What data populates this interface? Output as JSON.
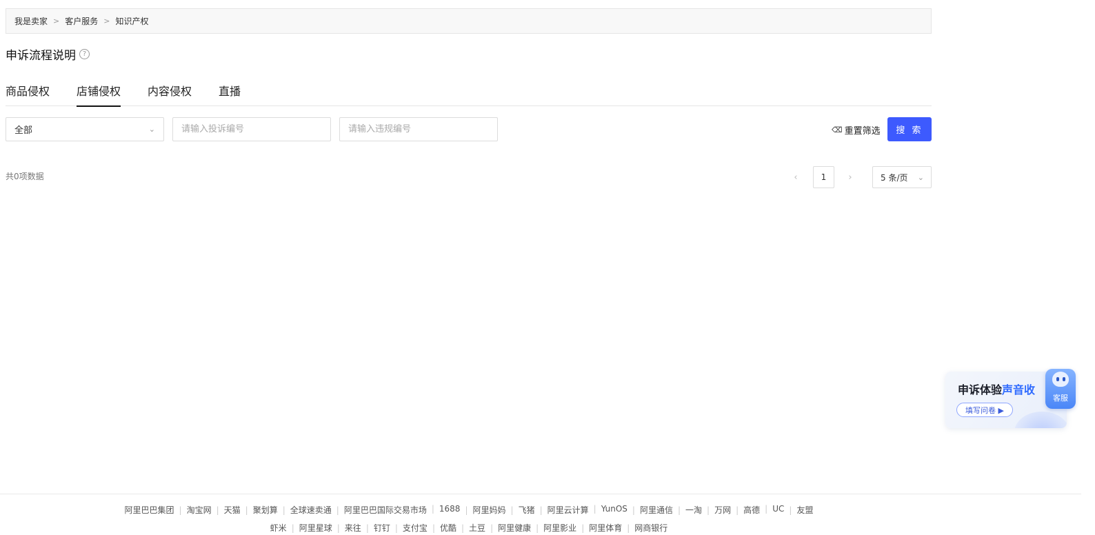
{
  "breadcrumb": {
    "items": [
      "我是卖家",
      "客户服务",
      "知识产权"
    ],
    "separator": ">"
  },
  "page_title": "申诉流程说明",
  "help_icon": "?",
  "tabs": [
    {
      "label": "商品侵权",
      "active": false
    },
    {
      "label": "店铺侵权",
      "active": true
    },
    {
      "label": "内容侵权",
      "active": false
    },
    {
      "label": "直播",
      "active": false
    }
  ],
  "filters": {
    "type_select": {
      "value": "全部"
    },
    "complaint_no": {
      "placeholder": "请输入投诉编号",
      "value": ""
    },
    "violation_no": {
      "placeholder": "请输入违规编号",
      "value": ""
    },
    "reset_label": "重置筛选",
    "search_label": "搜 索"
  },
  "results": {
    "total_text": "共0项数据"
  },
  "pagination": {
    "prev_icon": "‹",
    "next_icon": "›",
    "current_page": "1",
    "page_size": "5 条/页"
  },
  "survey": {
    "title_prefix": "申诉体验",
    "title_highlight": "声音收",
    "button_label": "填写问卷 ▶"
  },
  "customer_service": {
    "label": "客服"
  },
  "footer": {
    "row1": [
      "阿里巴巴集团",
      "淘宝网",
      "天猫",
      "聚划算",
      "全球速卖通",
      "阿里巴巴国际交易市场",
      "1688",
      "阿里妈妈",
      "飞猪",
      "阿里云计算",
      "YunOS",
      "阿里通信",
      "一淘",
      "万网",
      "高德",
      "UC",
      "友盟"
    ],
    "row2": [
      "虾米",
      "阿里星球",
      "来往",
      "钉钉",
      "支付宝",
      "优酷",
      "土豆",
      "阿里健康",
      "阿里影业",
      "阿里体育",
      "网商银行"
    ]
  },
  "colors": {
    "primary": "#3d5afe",
    "survey_highlight": "#2f6bff",
    "cs_button": "#4a86f7"
  }
}
